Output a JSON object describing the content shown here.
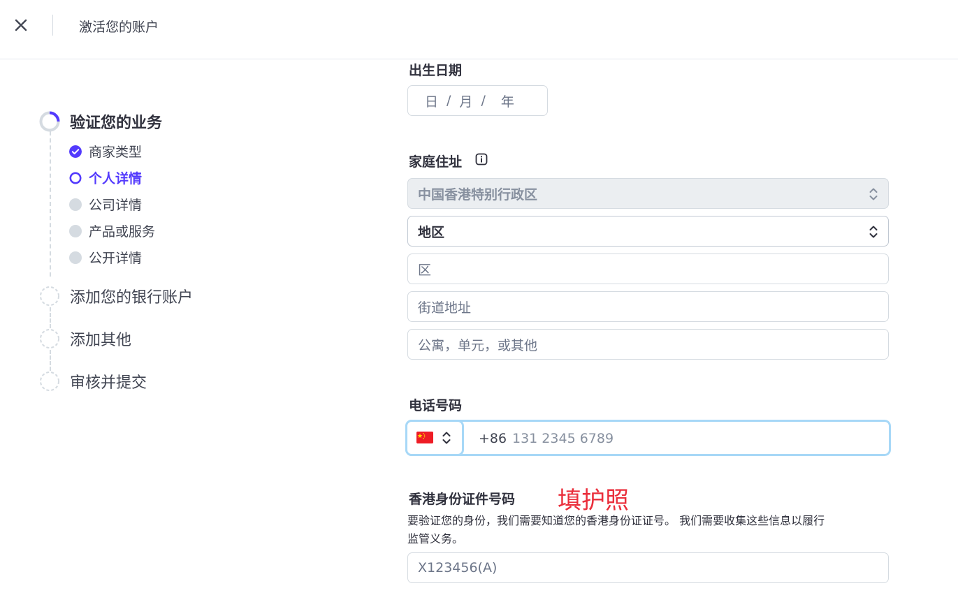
{
  "header": {
    "title": "激活您的账户"
  },
  "stepper": {
    "steps": [
      {
        "label": "验证您的业务",
        "status": "in-progress",
        "substeps": [
          {
            "label": "商家类型",
            "status": "complete"
          },
          {
            "label": "个人详情",
            "status": "current"
          },
          {
            "label": "公司详情",
            "status": "upcoming"
          },
          {
            "label": "产品或服务",
            "status": "upcoming"
          },
          {
            "label": "公开详情",
            "status": "upcoming"
          }
        ]
      },
      {
        "label": "添加您的银行账户",
        "status": "upcoming"
      },
      {
        "label": "添加其他",
        "status": "upcoming"
      },
      {
        "label": "审核并提交",
        "status": "upcoming"
      }
    ]
  },
  "form": {
    "dob": {
      "label": "出生日期",
      "day_placeholder": "日",
      "sep1": "/",
      "month_placeholder": "月",
      "sep2": "/",
      "year_placeholder": "年"
    },
    "address": {
      "label": "家庭住址",
      "info_icon": "info-icon",
      "country_value": "中国香港特别行政区",
      "region_value": "地区",
      "district_placeholder": "区",
      "street_placeholder": "街道地址",
      "unit_placeholder": "公寓，单元，或其他"
    },
    "phone": {
      "label": "电话号码",
      "country_flag": "china-flag-icon",
      "prefix": "+86",
      "placeholder": "131 2345 6789"
    },
    "hkid": {
      "label": "香港身份证件号码",
      "annotation": "填护照",
      "help_line1": "要验证您的身份，我们需要知道您的香港身份证证号。 我们需要收集这些信息以履行",
      "help_line2": "监管义务。",
      "placeholder": "X123456(A)"
    }
  },
  "colors": {
    "accent": "#533afd",
    "annotation": "#ea2e3b",
    "focus_ring": "#a7d8f7",
    "upcoming_dot": "#d5dbe1"
  }
}
